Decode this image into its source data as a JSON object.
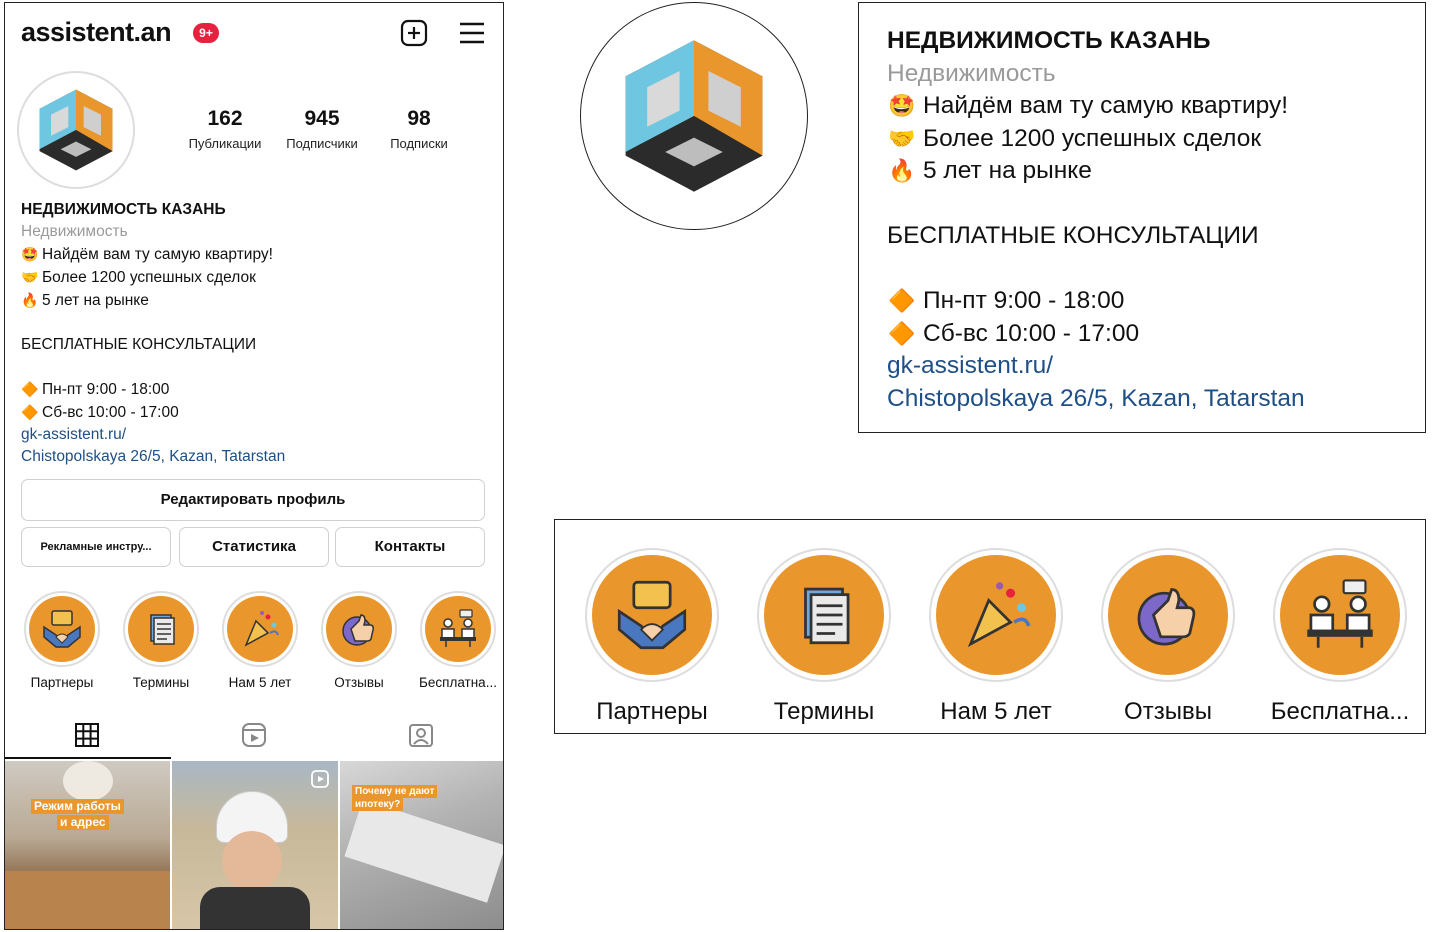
{
  "header": {
    "username": "assistent.an",
    "notification_badge": "9+",
    "add_icon": "plus-square-icon",
    "menu_icon": "hamburger-menu-icon"
  },
  "profile": {
    "avatar_icon": "orange-cube-logo",
    "stats": [
      {
        "value": "162",
        "label": "Публикации"
      },
      {
        "value": "945",
        "label": "Подписчики"
      },
      {
        "value": "98",
        "label": "Подписки"
      }
    ]
  },
  "bio": {
    "name": "НЕДВИЖИМОСТЬ КАЗАНЬ",
    "category": "Недвижимость",
    "line1": "Найдём вам ту самую квартиру!",
    "line2": "Более 1200 успешных сделок",
    "line3": "5 лет на рынке",
    "consult": "БЕСПЛАТНЫЕ КОНСУЛЬТАЦИИ",
    "hours1": "Пн-пт 9:00 - 18:00",
    "hours2": "Сб-вс 10:00 - 17:00",
    "website": "gk-assistent.ru/",
    "address": "Chistopolskaya 26/5, Kazan, Tatarstan",
    "emoji_smile": "🤩",
    "emoji_hand": "🤝",
    "emoji_fire": "🔥",
    "emoji_diamond": "🔶"
  },
  "buttons": {
    "edit_profile": "Редактировать профиль",
    "ad_tools": "Рекламные инстру...",
    "statistics": "Статистика",
    "contacts": "Контакты"
  },
  "highlights": [
    {
      "label": "Партнеры",
      "icon": "handshake-icon"
    },
    {
      "label": "Термины",
      "icon": "document-icon"
    },
    {
      "label": "Нам 5 лет",
      "icon": "party-popper-icon"
    },
    {
      "label": "Отзывы",
      "icon": "thumbs-up-icon"
    },
    {
      "label": "Бесплатна...",
      "icon": "consultation-icon"
    }
  ],
  "tabs": [
    {
      "icon": "grid-icon",
      "active": true
    },
    {
      "icon": "reels-icon",
      "active": false
    },
    {
      "icon": "tagged-icon",
      "active": false
    }
  ],
  "posts": [
    {
      "caption_line1": "Режим работы",
      "caption_line2": "и адрес"
    },
    {
      "caption_line1": "",
      "caption_line2": ""
    },
    {
      "caption_line1": "Почему не дают",
      "caption_line2": "ипотеку?"
    }
  ],
  "colors": {
    "accent_orange": "#e9962c",
    "link_blue": "#1e4f86",
    "badge_red": "#e8213f",
    "muted_gray": "#9a9a9a"
  }
}
